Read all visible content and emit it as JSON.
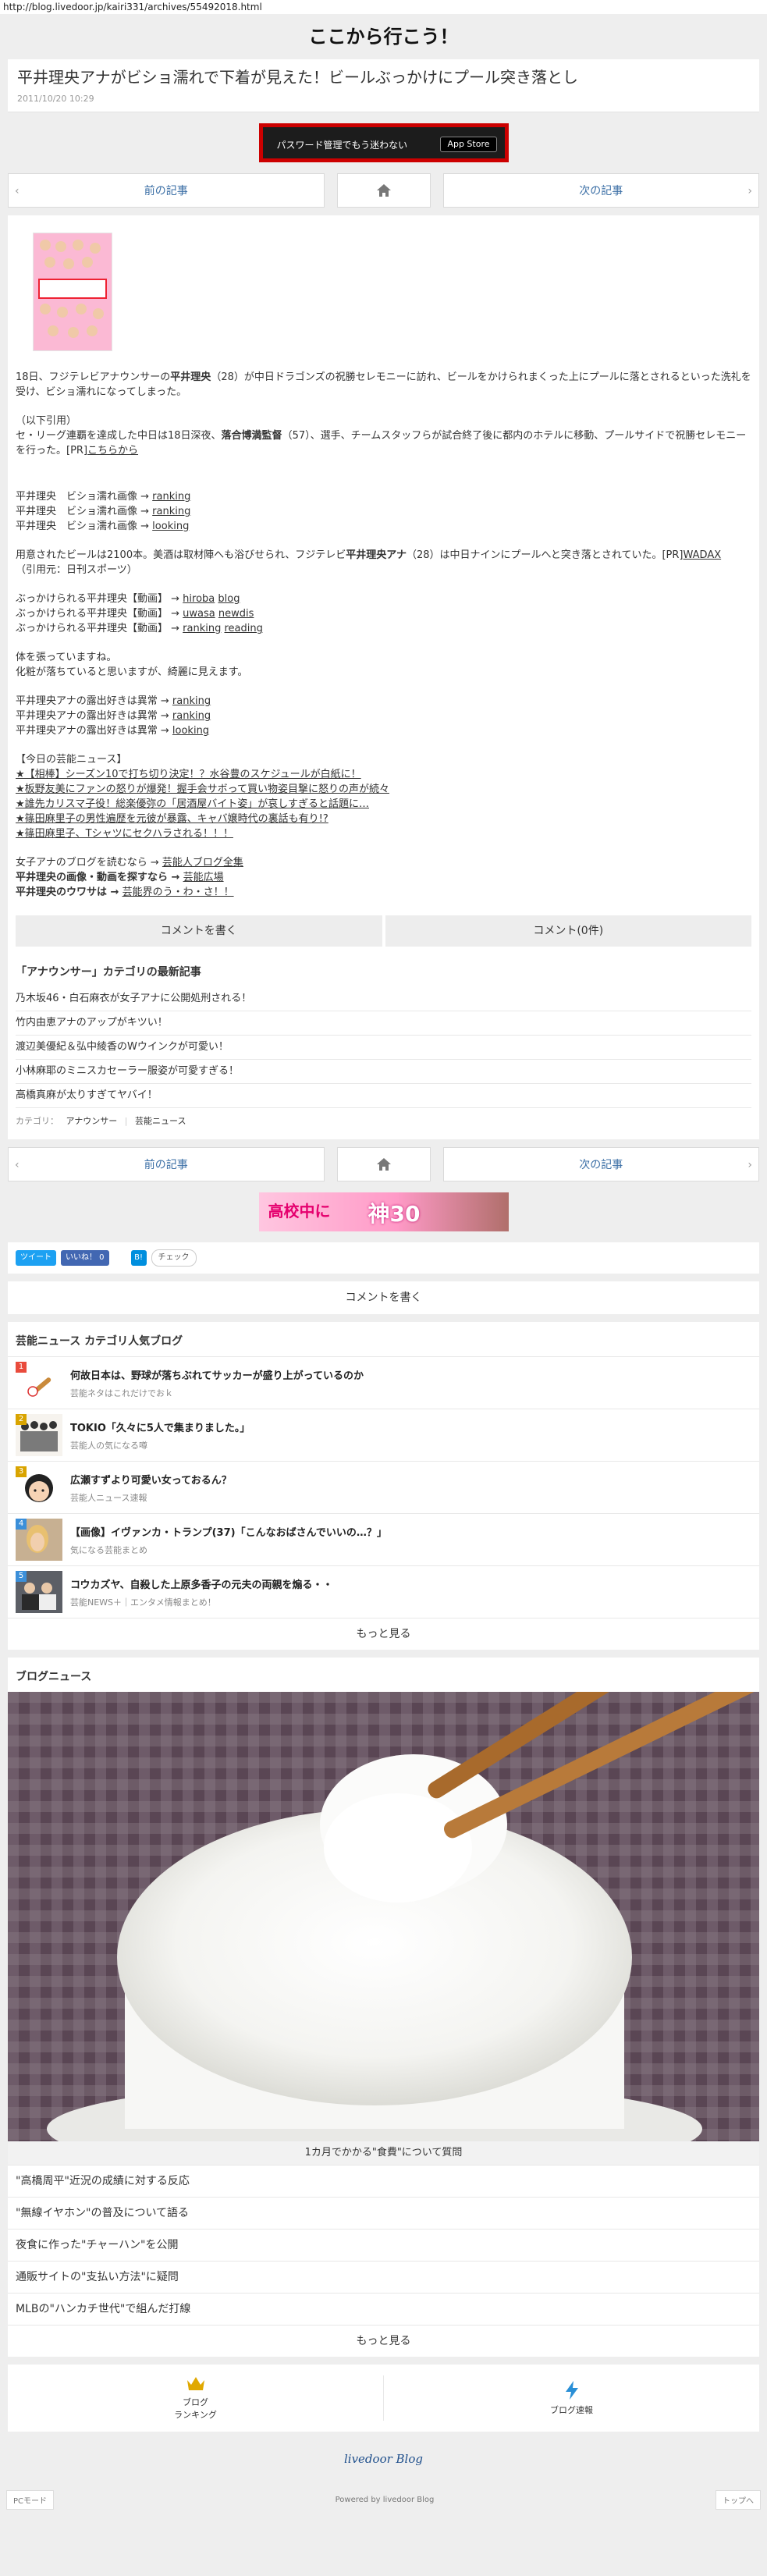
{
  "url": "http://blog.livedoor.jp/kairi331/archives/55492018.html",
  "blog_title": "ここから行こう！",
  "article": {
    "title": "平井理央アナがビショ濡れで下着が見えた！ビールぶっかけにプール突き落とし",
    "date": "2011/10/20 10:29"
  },
  "ad_top": {
    "text": "パスワード管理でもう迷わない",
    "badge": "App Store"
  },
  "nav": {
    "prev": "前の記事",
    "next": "次の記事"
  },
  "content": {
    "p1_a": "18日、フジテレビアナウンサーの",
    "p1_name": "平井理央",
    "p1_b": "（28）が中日ドラゴンズの祝勝セレモニーに訪れ、ビールをかけられまくった上にプールに落とされるといった洗礼を受け、ビショ濡れになってしまった。",
    "quote_label": "（以下引用）",
    "p2_a": "セ・リーグ連覇を達成した中日は18日深夜、",
    "p2_name": "落合博満監督",
    "p2_b": "（57）、選手、チームスタッフらが試合終了後に都内のホテルに移動、プールサイドで祝勝セレモニーを行った。[PR]",
    "p2_link": "こちらから",
    "img_label": "平井理央　ビショ濡れ画像 →",
    "img_link": "ranking",
    "img_label2": "平井理央　ビショ濡れ画像 →",
    "img_link2": "ranking",
    "img_label3": "平井理央　ビショ濡れ画像 →",
    "img_link3": "looking",
    "p3_a": "用意されたビールは2100本。美酒は取材陣へも浴びせられ、フジテレビ",
    "p3_name": "平井理央アナ",
    "p3_b": "（28）は中日ナインにプールへと突き落とされていた。[PR]",
    "p3_link": "WADAX",
    "source": "（引用元：日刊スポーツ）",
    "v1_label": "ぶっかけられる平井理央【動画】 →",
    "v1_link1": "hiroba",
    "v1_link2": "blog",
    "v2_label": "ぶっかけられる平井理央【動画】 →",
    "v2_link1": "uwasa",
    "v2_link2": "newdis",
    "v3_label": "ぶっかけられる平井理央【動画】 →",
    "v3_link1": "ranking",
    "v3_link2": "reading",
    "c1": "体を張っていますね。",
    "c2": "化粧が落ちていると思いますが、綺麗に見えます。",
    "e1_label": "平井理央アナの露出好きは異常 →",
    "e1_link": "ranking",
    "e2_label": "平井理央アナの露出好きは異常 →",
    "e2_link": "ranking",
    "e3_label": "平井理央アナの露出好きは異常 →",
    "e3_link": "looking",
    "today_h": "【今日の芸能ニュース】",
    "n1": "★【相棒】シーズン10で打ち切り決定！？水谷豊のスケジュールが白紙に！",
    "n2": "★板野友美にファンの怒りが爆発！握手会サボって買い物姿目撃に怒りの声が続々",
    "n3": "★誰先カリスマ子役！総楽優弥の「居酒屋バイト姿」が哀しすぎると話題に…",
    "n4": "★篠田麻里子の男性遍歴を元彼が暴露、キャバ嬢時代の裏話も有り!?",
    "n5": "★篠田麻里子、Tシャツにセクハラされる！！！",
    "l1_label": "女子アナのブログを読むなら →",
    "l1_link": "芸能人ブログ全集",
    "l2_label": "平井理央の画像・動画を探すなら →",
    "l2_link": "芸能広場",
    "l3_label": "平井理央のウワサは →",
    "l3_link": "芸能界のう・わ・さ！！"
  },
  "comment_bar": {
    "write": "コメントを書く",
    "count": "コメント(0件)"
  },
  "category": {
    "heading": "「アナウンサー」カテゴリの最新記事",
    "items": [
      "乃木坂46・白石麻衣が女子アナに公開処刑される！",
      "竹内由恵アナのアップがキツい！",
      "渡辺美優紀＆弘中綾香のWウインクが可愛い！",
      "小林麻耶のミニスカセーラー服姿が可愛すぎる！",
      "高橋真麻が太りすぎてヤバイ！"
    ],
    "label": "カテゴリ：",
    "cat1": "アナウンサー",
    "cat2": "芸能ニュース"
  },
  "ad_bottom": {
    "t1": "高校中に",
    "t2": "神30"
  },
  "share": {
    "tweet": "ツイート",
    "like": "いいね！ 0",
    "hatena": "B!",
    "check": "チェック"
  },
  "write_comment": "コメントを書く",
  "ranking": {
    "heading": "芸能ニュース カテゴリ人気ブログ",
    "items": [
      {
        "num": "1",
        "title": "何故日本は、野球が落ちぶれてサッカーが盛り上がっているのか",
        "blog": "芸能ネタはこれだけでおｋ"
      },
      {
        "num": "2",
        "title": "TOKIO「久々に5人で集まりました。」",
        "blog": "芸能人の気になる噂"
      },
      {
        "num": "3",
        "title": "広瀬すずより可愛い女っておるん？",
        "blog": "芸能人ニュース速報"
      },
      {
        "num": "4",
        "title": "【画像】イヴァンカ・トランプ(37)「こんなおばさんでいいの…？」",
        "blog": "気になる芸能まとめ"
      },
      {
        "num": "5",
        "title": "コウカズヤ、自殺した上原多香子の元夫の両親を煽る・・",
        "blog": "芸能NEWS＋｜エンタメ情報まとめ！"
      }
    ],
    "more": "もっと見る"
  },
  "blog_news": {
    "heading": "ブログニュース",
    "caption": "1カ月でかかる\"食費\"について質問",
    "items": [
      "\"高橋周平\"近況の成績に対する反応",
      "\"無線イヤホン\"の普及について語る",
      "夜食に作った\"チャーハン\"を公開",
      "通販サイトの\"支払い方法\"に疑問",
      "MLBの\"ハンカチ世代\"で組んだ打線"
    ],
    "more": "もっと見る"
  },
  "app_nav": {
    "ranking": "ブログ\nランキング",
    "speed": "ブログ速報"
  },
  "logo": "livedoor Blog",
  "footer": {
    "pc": "PCモード",
    "powered": "Powered by livedoor Blog",
    "top": "トップへ"
  },
  "colors": {
    "link": "#3a6ea5",
    "accent_red": "#cc0000",
    "twitter": "#1da1f2",
    "facebook": "#4267b2"
  }
}
